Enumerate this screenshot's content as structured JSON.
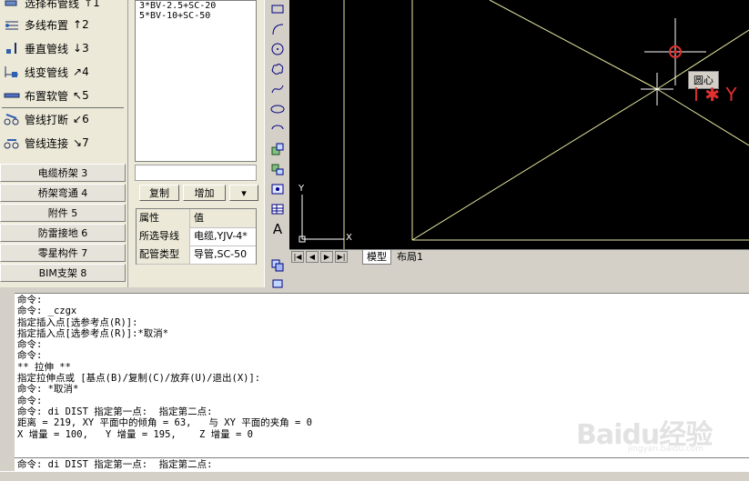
{
  "left_panel": {
    "tools": [
      {
        "label": "选择布管线",
        "shortcut": "↑1",
        "icon": "select-line-icon"
      },
      {
        "label": "多线布置",
        "shortcut": "↑2",
        "icon": "multi-line-icon"
      },
      {
        "label": "垂直管线",
        "shortcut": "↓3",
        "icon": "vertical-pipe-icon"
      },
      {
        "label": "线变管线",
        "shortcut": "↗4",
        "icon": "line-to-pipe-icon"
      },
      {
        "label": "布置软管",
        "shortcut": "↖5",
        "icon": "soft-pipe-icon"
      },
      {
        "label": "管线打断",
        "shortcut": "↙6",
        "icon": "break-pipe-icon"
      },
      {
        "label": "管线连接",
        "shortcut": "↘7",
        "icon": "connect-pipe-icon"
      }
    ],
    "categories": [
      "电缆桥架 3",
      "桥架弯通 4",
      "附件 5",
      "防雷接地 6",
      "零星构件 7",
      "BIM支架 8"
    ]
  },
  "mid_panel": {
    "list_items": [
      "3*BV-2.5+SC-20",
      "5*BV-10+SC-50"
    ],
    "buttons": {
      "copy": "复制",
      "add": "增加",
      "more": "▾"
    },
    "properties": {
      "header": {
        "name": "属性",
        "value": "值"
      },
      "rows": [
        {
          "name": "所选导线",
          "value": "电缆,YJV-4*"
        },
        {
          "name": "配管类型",
          "value": "导管,SC-50"
        }
      ]
    }
  },
  "canvas": {
    "background": "#000000",
    "line_color": "#e8e8a0",
    "tooltip": "圆心",
    "axis_x": "X",
    "axis_y": "Y",
    "red_text": "I ✱ Y",
    "marker_color": "#e03030"
  },
  "tabs": [
    "模型",
    "布局1"
  ],
  "command": {
    "history": [
      "命令:",
      "命令: _czgx",
      "指定插入点[选参考点(R)]:",
      "指定插入点[选参考点(R)]:*取消*",
      "命令:",
      "命令:",
      "** 拉伸 **",
      "指定拉伸点或 [基点(B)/复制(C)/放弃(U)/退出(X)]:",
      "命令: *取消*",
      "命令:",
      "命令: di DIST 指定第一点:  指定第二点:",
      "距离 = 219, XY 平面中的倾角 = 63,   与 XY 平面的夹角 = 0",
      "X 增量 = 100,   Y 增量 = 195,    Z 增量 = 0"
    ],
    "current": "命令: di DIST 指定第一点:  指定第二点:"
  },
  "watermark": {
    "text": "Baidu经验",
    "sub": "jingyan.baidu.com"
  }
}
